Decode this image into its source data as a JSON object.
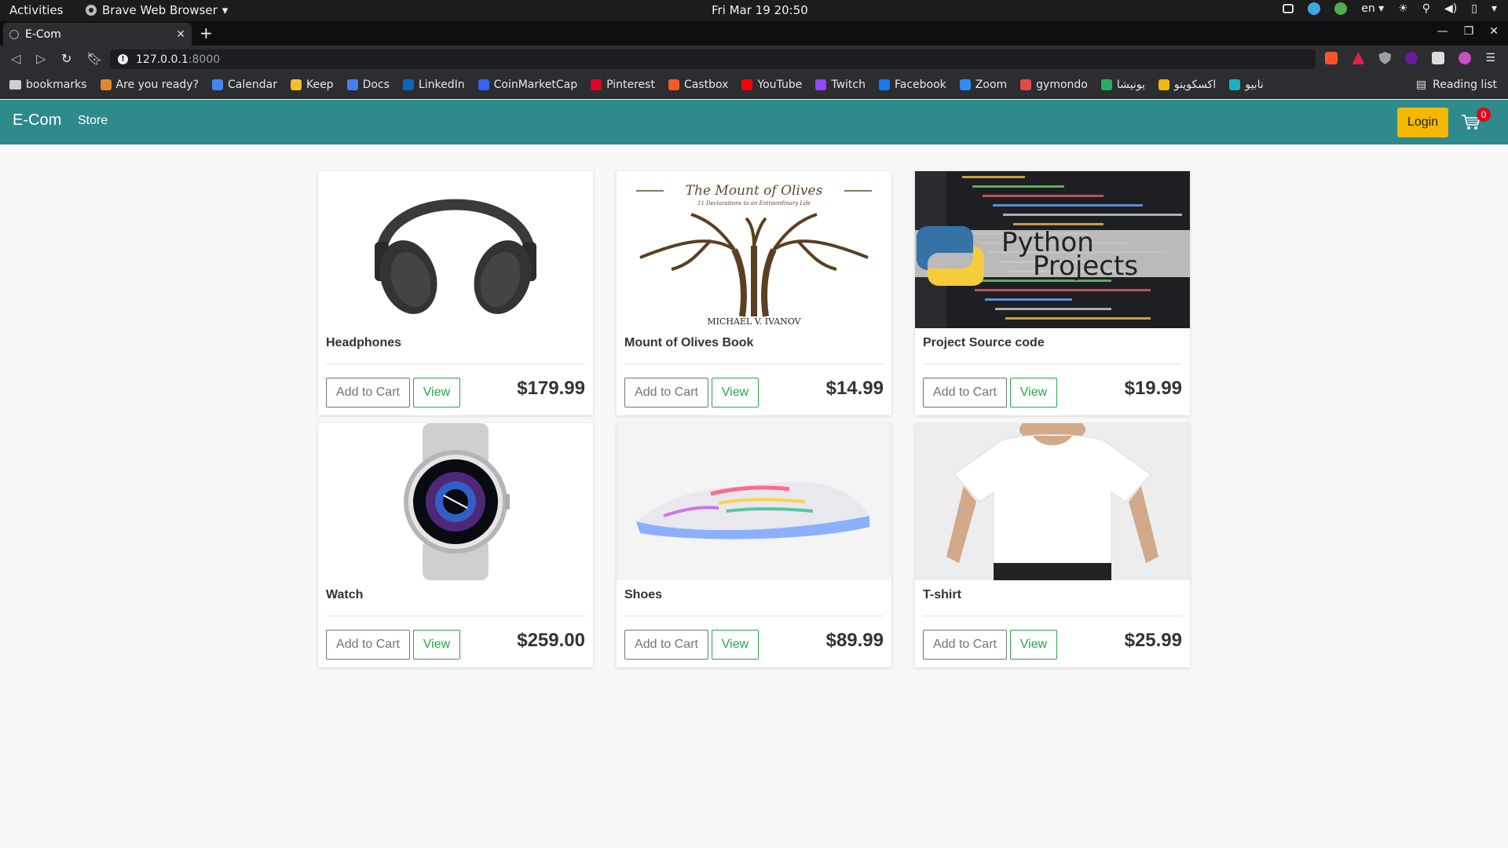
{
  "os": {
    "activities": "Activities",
    "app_name": "Brave Web Browser",
    "clock": "Fri Mar 19  20:50",
    "lang": "en"
  },
  "browser": {
    "tab_title": "E-Com",
    "url_host": "127.0.0.1",
    "url_port": ":8000",
    "bookmarks": [
      {
        "label": "bookmarks",
        "color": "#cfcfcf"
      },
      {
        "label": "Are you ready?",
        "color": "#e0872c"
      },
      {
        "label": "Calendar",
        "color": "#4285f4"
      },
      {
        "label": "Keep",
        "color": "#f6bf26"
      },
      {
        "label": "Docs",
        "color": "#4a7cf0"
      },
      {
        "label": "LinkedIn",
        "color": "#0a66c2"
      },
      {
        "label": "CoinMarketCap",
        "color": "#3861fb"
      },
      {
        "label": "Pinterest",
        "color": "#e60023"
      },
      {
        "label": "Castbox",
        "color": "#f55b23"
      },
      {
        "label": "YouTube",
        "color": "#ff0000"
      },
      {
        "label": "Twitch",
        "color": "#9146ff"
      },
      {
        "label": "Facebook",
        "color": "#1877f2"
      },
      {
        "label": "Zoom",
        "color": "#2d8cff"
      },
      {
        "label": "gymondo",
        "color": "#e5474e"
      },
      {
        "label": "یونیشا",
        "color": "#27ae60"
      },
      {
        "label": "اکسکوینو",
        "color": "#f0b90b"
      },
      {
        "label": "نابیو",
        "color": "#19b3c4"
      }
    ],
    "reading_list": "Reading list"
  },
  "site": {
    "brand": "E-Com",
    "nav_store": "Store",
    "login": "Login",
    "cart_count": "0",
    "colors": {
      "navbar": "#2e8a8b",
      "login": "#f5b800",
      "view": "#28a745",
      "badge": "#e8001c"
    }
  },
  "products": [
    {
      "name": "Headphones",
      "price": "$179.99",
      "add_label": "Add to Cart",
      "view_label": "View",
      "image": "headphones"
    },
    {
      "name": "Mount of Olives Book",
      "price": "$14.99",
      "add_label": "Add to Cart",
      "view_label": "View",
      "image": "book-cover",
      "image_text": {
        "title": "The Mount of Olives",
        "subtitle": "11 Declarations to an Extraordinary Life",
        "author": "MICHAEL V. IVANOV"
      }
    },
    {
      "name": "Project Source code",
      "price": "$19.99",
      "add_label": "Add to Cart",
      "view_label": "View",
      "image": "python-projects",
      "image_text": {
        "line1": "Python",
        "line2": "Projects"
      }
    },
    {
      "name": "Watch",
      "price": "$259.00",
      "add_label": "Add to Cart",
      "view_label": "View",
      "image": "smartwatch"
    },
    {
      "name": "Shoes",
      "price": "$89.99",
      "add_label": "Add to Cart",
      "view_label": "View",
      "image": "sneaker"
    },
    {
      "name": "T-shirt",
      "price": "$25.99",
      "add_label": "Add to Cart",
      "view_label": "View",
      "image": "white-tshirt"
    }
  ]
}
